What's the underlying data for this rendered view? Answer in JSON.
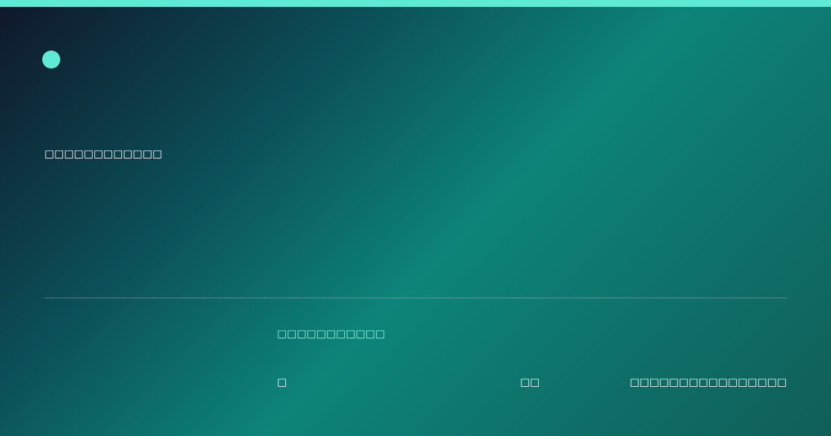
{
  "colors": {
    "accent": "#5eead4",
    "label": "#99f6e4",
    "text": "#ffffff"
  },
  "card": {
    "headline": "□□□□□□□□□□□□",
    "section_label": "□□□□□□□□□□□",
    "meta_left": "□",
    "meta_mid": "□□",
    "meta_right": "□□□□□□□□□□□□□□□□"
  }
}
